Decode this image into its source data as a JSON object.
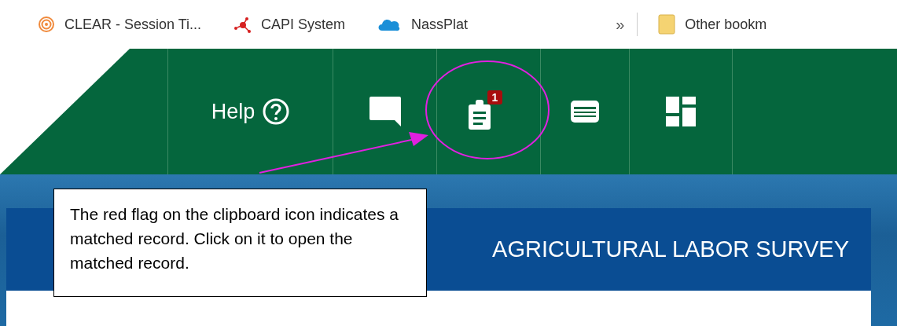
{
  "bookmarks_bar": {
    "bookmarks": [
      {
        "kind": "rings",
        "label": "CLEAR - Session Ti..."
      },
      {
        "kind": "nodes",
        "label": "CAPI System"
      },
      {
        "kind": "cloud",
        "label": "NassPlat"
      }
    ],
    "overflow": "»",
    "other": "Other bookm"
  },
  "nav": {
    "items": [
      {
        "kind": "help",
        "label": "Help"
      },
      {
        "kind": "chat"
      },
      {
        "kind": "clipboard",
        "badge": "1"
      },
      {
        "kind": "card"
      },
      {
        "kind": "dashboard"
      }
    ]
  },
  "banner": {
    "title": "AGRICULTURAL LABOR SURVEY"
  },
  "callout": {
    "text": "The red flag on the clipboard icon indicates a matched record. Click on it to open the matched record."
  }
}
